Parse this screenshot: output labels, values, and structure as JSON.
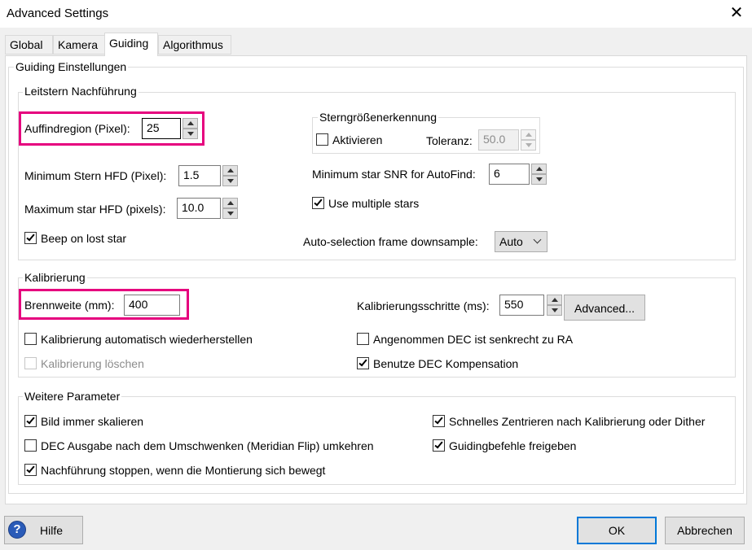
{
  "window": {
    "title": "Advanced Settings",
    "close_glyph": "✕"
  },
  "tabs": [
    {
      "label": "Global"
    },
    {
      "label": "Kamera"
    },
    {
      "label": "Guiding",
      "active": true
    },
    {
      "label": "Algorithmus"
    }
  ],
  "guiding_group": {
    "title": "Guiding Einstellungen"
  },
  "leitstern": {
    "title": "Leitstern  Nachführung",
    "search_region": {
      "label": "Auffindregion (Pixel):",
      "value": "25"
    },
    "min_hfd": {
      "label": "Minimum Stern HFD (Pixel):",
      "value": "1.5"
    },
    "max_hfd": {
      "label": "Maximum star HFD (pixels):",
      "value": "10.0"
    },
    "beep": {
      "label": "Beep on lost star",
      "checked": true
    },
    "star_mass": {
      "title": "Sterngrößenerkennung",
      "enable": {
        "label": "Aktivieren",
        "checked": false
      },
      "tolerance": {
        "label": "Toleranz:",
        "value": "50.0"
      }
    },
    "min_snr": {
      "label": "Minimum star SNR for AutoFind:",
      "value": "6"
    },
    "multi_star": {
      "label": "Use multiple stars",
      "checked": true
    },
    "downsample": {
      "label": "Auto-selection frame downsample:",
      "value": "Auto"
    }
  },
  "kalibrierung": {
    "title": "Kalibrierung",
    "focal_length": {
      "label": "Brennweite (mm):",
      "value": "400"
    },
    "step": {
      "label": "Kalibrierungsschritte (ms):",
      "value": "550"
    },
    "advanced_button": "Advanced...",
    "auto_restore": {
      "label": "Kalibrierung automatisch wiederherstellen",
      "checked": false
    },
    "clear": {
      "label": "Kalibrierung löschen",
      "checked": false,
      "disabled": true
    },
    "assume_orth": {
      "label": "Angenommen DEC ist senkrecht zu RA",
      "checked": false
    },
    "dec_comp": {
      "label": "Benutze DEC Kompensation",
      "checked": true
    }
  },
  "weitere": {
    "title": "Weitere Parameter",
    "scale_image": {
      "label": "Bild immer skalieren",
      "checked": true
    },
    "reverse_dec": {
      "label": "DEC Ausgabe nach dem Umschwenken (Meridian Flip) umkehren",
      "checked": false
    },
    "stop_guiding": {
      "label": "Nachführung stoppen, wenn die Montierung sich bewegt",
      "checked": true
    },
    "fast_recenter": {
      "label": "Schnelles Zentrieren nach Kalibrierung oder Dither",
      "checked": true
    },
    "enable_guide": {
      "label": "Guidingbefehle freigeben",
      "checked": true
    }
  },
  "footer": {
    "help_icon_glyph": "?",
    "help_label": "Hilfe",
    "ok_label": "OK",
    "cancel_label": "Abbrechen"
  },
  "colors": {
    "highlight": "#e6007e",
    "focus": "#0078d7"
  }
}
